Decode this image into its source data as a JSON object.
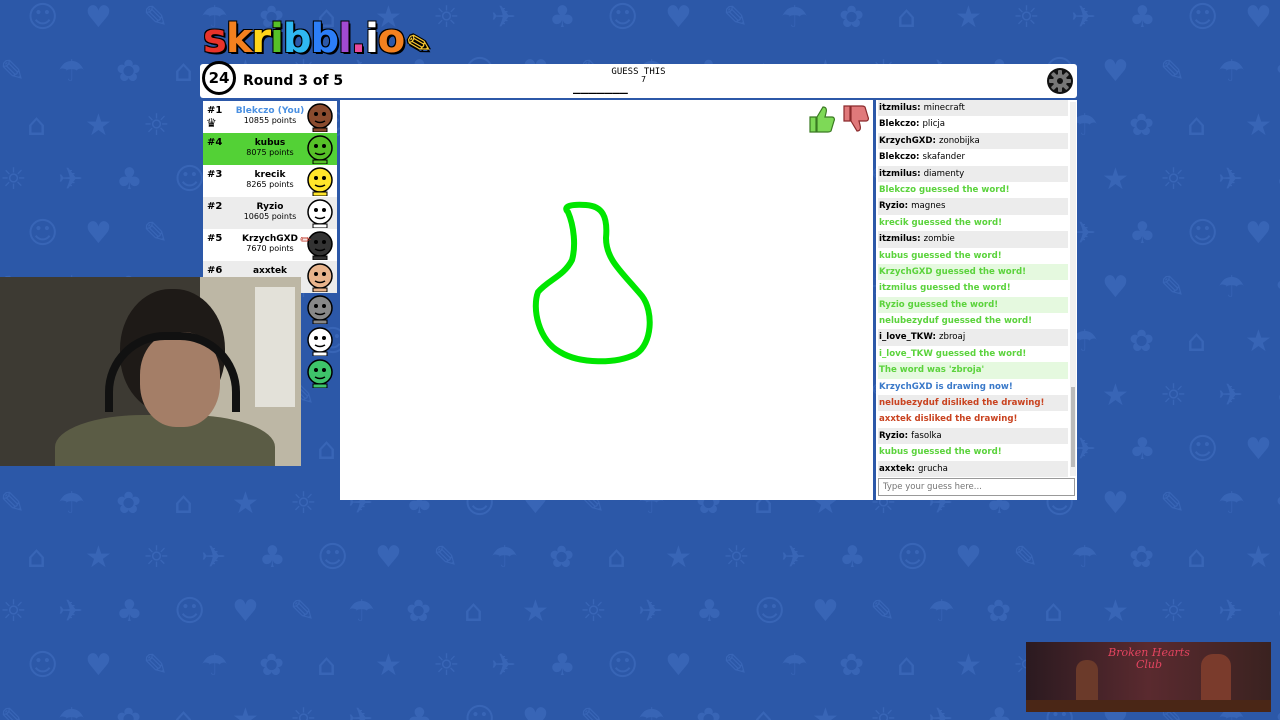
{
  "logo": {
    "text": "skribbl.io",
    "letter_colors": [
      "#e8332a",
      "#f4811f",
      "#ffd51a",
      "#56c128",
      "#2fb8f1",
      "#2c7ef8",
      "#a14ad1",
      "#e84a9c",
      "#ffffff",
      "#f4811f"
    ]
  },
  "topbar": {
    "timer": "24",
    "round": "Round 3 of 5",
    "guess_label": "GUESS THIS",
    "word_blanks": "_______",
    "word_length": "7",
    "settings_icon": "gear-icon"
  },
  "players": [
    {
      "rank": "#1",
      "name": "Blekczo (You)",
      "points": "10855 points",
      "is_you": true,
      "drawing": false,
      "avatar_color": "#8a4b2e",
      "crown": true
    },
    {
      "rank": "#4",
      "name": "kubus",
      "points": "8075 points",
      "is_you": false,
      "drawing": true,
      "avatar_color": "#56c128",
      "crown": false
    },
    {
      "rank": "#3",
      "name": "krecik",
      "points": "8265 points",
      "is_you": false,
      "drawing": false,
      "avatar_color": "#ffe52a",
      "crown": false
    },
    {
      "rank": "#2",
      "name": "Ryzio",
      "points": "10605 points",
      "is_you": false,
      "drawing": false,
      "avatar_color": "#ffffff",
      "crown": false
    },
    {
      "rank": "#5",
      "name": "KrzychGXD",
      "points": "7670 points",
      "is_you": false,
      "drawing": false,
      "avatar_color": "#333333",
      "crown": false,
      "pencil": true
    },
    {
      "rank": "#6",
      "name": "axxtek",
      "points": "",
      "is_you": false,
      "drawing": false,
      "avatar_color": "#e8b48c",
      "crown": false
    }
  ],
  "extra_avatars": [
    "#888888",
    "#ffffff",
    "#3ec46a"
  ],
  "bubbles": [
    {
      "text": "fasolka"
    },
    {
      "text": "grucha"
    }
  ],
  "canvas": {
    "stroke_color": "#00e600"
  },
  "chat": {
    "messages": [
      {
        "type": "normal",
        "user": "itzmilus",
        "text": "minecraft"
      },
      {
        "type": "normal",
        "user": "Blekczo",
        "text": "plicja"
      },
      {
        "type": "normal",
        "user": "KrzychGXD",
        "text": "zonobijka"
      },
      {
        "type": "normal",
        "user": "Blekczo",
        "text": "skafander"
      },
      {
        "type": "normal",
        "user": "itzmilus",
        "text": "diamenty"
      },
      {
        "type": "correct",
        "user": "",
        "text": "Blekczo guessed the word!"
      },
      {
        "type": "normal",
        "user": "Ryzio",
        "text": "magnes"
      },
      {
        "type": "correct",
        "user": "",
        "text": "krecik guessed the word!"
      },
      {
        "type": "normal",
        "user": "itzmilus",
        "text": "zombie"
      },
      {
        "type": "correct",
        "user": "",
        "text": "kubus guessed the word!"
      },
      {
        "type": "correct",
        "user": "",
        "text": "KrzychGXD guessed the word!"
      },
      {
        "type": "correct",
        "user": "",
        "text": "itzmilus guessed the word!"
      },
      {
        "type": "correct",
        "user": "",
        "text": "Ryzio guessed the word!"
      },
      {
        "type": "correct",
        "user": "",
        "text": "nelubezyduf guessed the word!"
      },
      {
        "type": "normal",
        "user": "i_love_TKW",
        "text": "zbroaj"
      },
      {
        "type": "correct",
        "user": "",
        "text": "i_love_TKW guessed the word!"
      },
      {
        "type": "correct",
        "user": "",
        "text": "The word was 'zbroja'"
      },
      {
        "type": "draw",
        "user": "",
        "text": "KrzychGXD is drawing now!"
      },
      {
        "type": "dislike",
        "user": "",
        "text": "nelubezyduf disliked the drawing!"
      },
      {
        "type": "dislike",
        "user": "",
        "text": "axxtek disliked the drawing!"
      },
      {
        "type": "normal",
        "user": "Ryzio",
        "text": "fasolka"
      },
      {
        "type": "correct",
        "user": "",
        "text": "kubus guessed the word!"
      },
      {
        "type": "normal",
        "user": "axxtek",
        "text": "grucha"
      }
    ],
    "input_placeholder": "Type your guess here..."
  },
  "corner_thumbnail": {
    "title": "Broken Hearts Club"
  }
}
